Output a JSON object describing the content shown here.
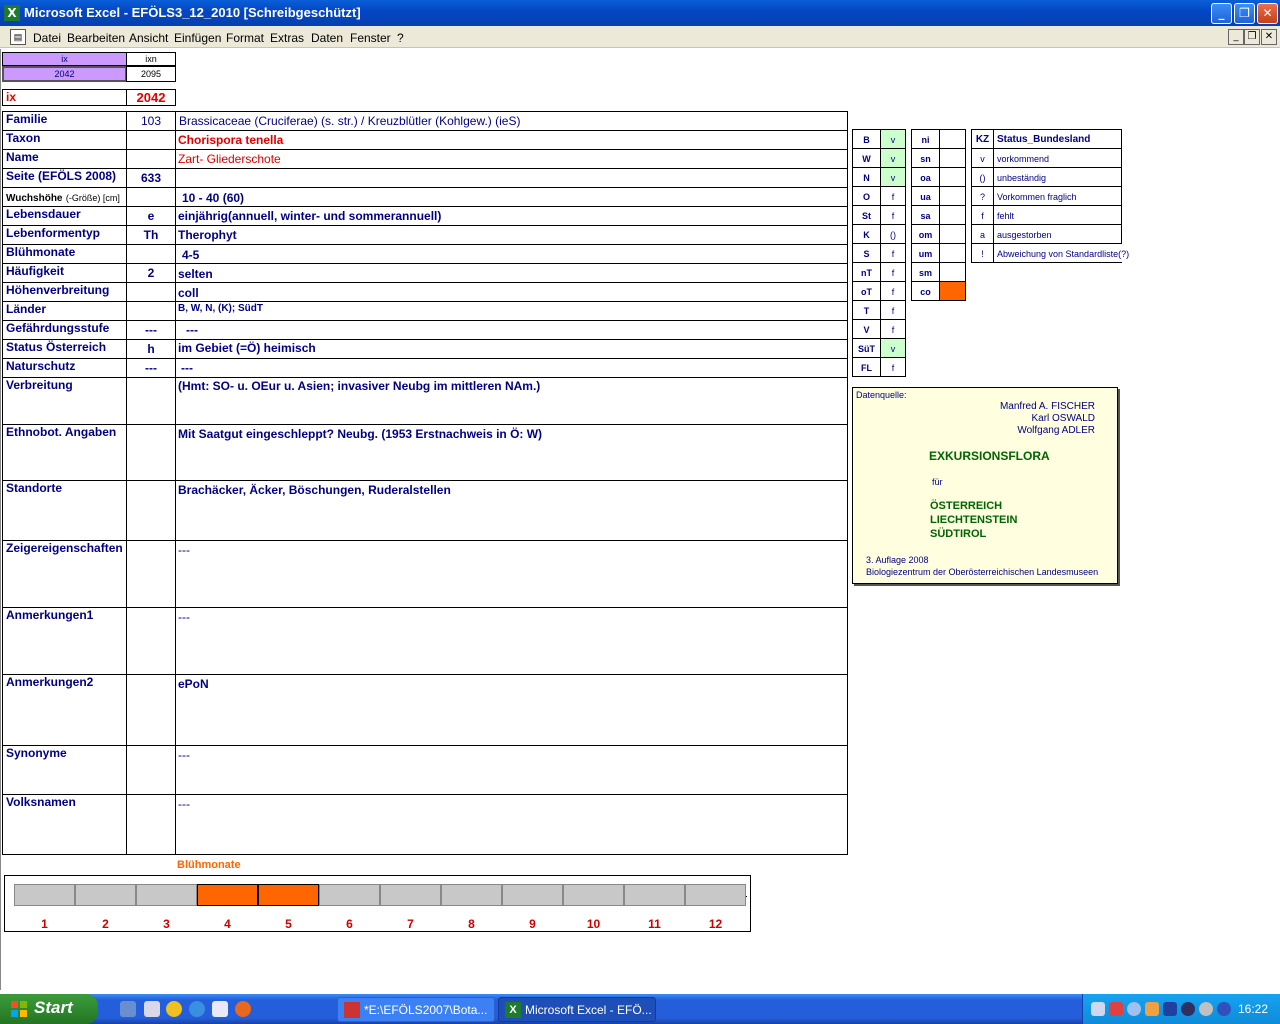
{
  "window": {
    "title": "Microsoft Excel - EFÖLS3_12_2010  [Schreibgeschützt]"
  },
  "menu": [
    "Datei",
    "Bearbeiten",
    "Ansicht",
    "Einfügen",
    "Format",
    "Extras",
    "Daten",
    "Fenster",
    "?"
  ],
  "nav": {
    "ix_label": "ix",
    "ixn_label": "ixn",
    "ix_value": "2042",
    "ixn_value": "2095"
  },
  "ix_row": {
    "label": "ix",
    "value": "2042"
  },
  "fields": {
    "familie": {
      "label": "Familie",
      "code": "103",
      "value": "Brassicaceae (Cruciferae) (s. str.)  /  Kreuzblütler (Kohlgew.) (ieS)"
    },
    "taxon": {
      "label": "Taxon",
      "value": "Chorispora tenella"
    },
    "name": {
      "label": "Name",
      "value": "Zart- Gliederschote"
    },
    "seite": {
      "label": "Seite (EFÖLS 2008)",
      "code": "633"
    },
    "wuchshoehe": {
      "label_main": "Wuchshöhe",
      "label_sub": "(-Größe) [cm]",
      "value": "10 - 40 (60)"
    },
    "lebensdauer": {
      "label": "Lebensdauer",
      "code": "e",
      "value": "einjährig(annuell, winter- und sommerannuell)"
    },
    "lebensformentyp": {
      "label": "Lebenformentyp",
      "code": "Th",
      "value": "Therophyt"
    },
    "bluehmonate": {
      "label": "Blühmonate",
      "value": "4-5"
    },
    "haeufigkeit": {
      "label": "Häufigkeit",
      "code": "2",
      "value": "selten"
    },
    "hoehenverbreitung": {
      "label": "Höhenverbreitung",
      "value": "coll"
    },
    "laender": {
      "label": "Länder",
      "value": "B, W, N, (K); SüdT"
    },
    "gefaehrdung": {
      "label": "Gefährdungsstufe",
      "code": "---",
      "value": "---"
    },
    "status": {
      "label": "Status Österreich",
      "code": "h",
      "value": "im Gebiet (=Ö) heimisch"
    },
    "naturschutz": {
      "label": "Naturschutz",
      "code": "---",
      "value": "---"
    },
    "verbreitung": {
      "label": "Verbreitung",
      "value": "(Hmt: SO- u. OEur u. Asien; invasiver Neubg im mittleren NAm.)"
    },
    "ethnobot": {
      "label": "Ethnobot. Angaben",
      "value": "Mit Saatgut eingeschleppt? Neubg. (1953 Erstnachweis in Ö: W)"
    },
    "standorte": {
      "label": "Standorte",
      "value": "Brachäcker, Äcker, Böschungen, Ruderalstellen"
    },
    "zeiger": {
      "label": "Zeigereigenschaften",
      "value": "---"
    },
    "anm1": {
      "label": "Anmerkungen1",
      "value": "---"
    },
    "anm2": {
      "label": "Anmerkungen2",
      "value": "ePoN"
    },
    "synonyme": {
      "label": "Synonyme",
      "value": "---"
    },
    "volksnamen": {
      "label": "Volksnamen",
      "value": "---"
    }
  },
  "states": [
    {
      "code": "B",
      "status": "v",
      "highlight": true
    },
    {
      "code": "W",
      "status": "v",
      "highlight": true
    },
    {
      "code": "N",
      "status": "v",
      "highlight": true
    },
    {
      "code": "O",
      "status": "f",
      "highlight": false
    },
    {
      "code": "St",
      "status": "f",
      "highlight": false
    },
    {
      "code": "K",
      "status": "()",
      "highlight": false
    },
    {
      "code": "S",
      "status": "f",
      "highlight": false
    },
    {
      "code": "nT",
      "status": "f",
      "highlight": false
    },
    {
      "code": "oT",
      "status": "f",
      "highlight": false
    },
    {
      "code": "T",
      "status": "f",
      "highlight": false
    },
    {
      "code": "V",
      "status": "f",
      "highlight": false
    },
    {
      "code": "SüT",
      "status": "v",
      "highlight": true
    },
    {
      "code": "FL",
      "status": "f",
      "highlight": false
    }
  ],
  "altitude": [
    "ni",
    "sn",
    "oa",
    "ua",
    "sa",
    "om",
    "um",
    "sm",
    "co"
  ],
  "altitude_active": "co",
  "legend": {
    "header_kz": "KZ",
    "header_status": "Status_Bundesland",
    "rows": [
      {
        "kz": "v",
        "text": "vorkommend"
      },
      {
        "kz": "()",
        "text": "unbeständig"
      },
      {
        "kz": "?",
        "text": "Vorkommen fraglich"
      },
      {
        "kz": "f",
        "text": "fehlt"
      },
      {
        "kz": "a",
        "text": "ausgestorben"
      },
      {
        "kz": "!",
        "text": "Abweichung von Standardliste(?)"
      }
    ]
  },
  "source": {
    "label": "Datenquelle:",
    "authors": [
      "Manfred A. FISCHER",
      "Karl OSWALD",
      "Wolfgang ADLER"
    ],
    "title": "EXKURSIONSFLORA",
    "fuer": "für",
    "countries": [
      "ÖSTERREICH",
      "LIECHTENSTEIN",
      "SÜDTIROL"
    ],
    "edition": "3. Auflage 2008",
    "publisher": "Biologiezentrum der Oberösterreichischen Landesmuseen"
  },
  "chart_data": {
    "type": "bar",
    "title": "Blühmonate",
    "categories": [
      "1",
      "2",
      "3",
      "4",
      "5",
      "6",
      "7",
      "8",
      "9",
      "10",
      "11",
      "12"
    ],
    "values": [
      0,
      0,
      0,
      1,
      1,
      0,
      0,
      0,
      0,
      0,
      0,
      0
    ],
    "colors": {
      "on": "#ff6600",
      "off": "#c8c8c8"
    }
  },
  "taskbar": {
    "start": "Start",
    "tasks": [
      "*E:\\EFÖLS2007\\Bota...",
      "Microsoft Excel - EFÖ..."
    ],
    "clock": "16:22"
  }
}
